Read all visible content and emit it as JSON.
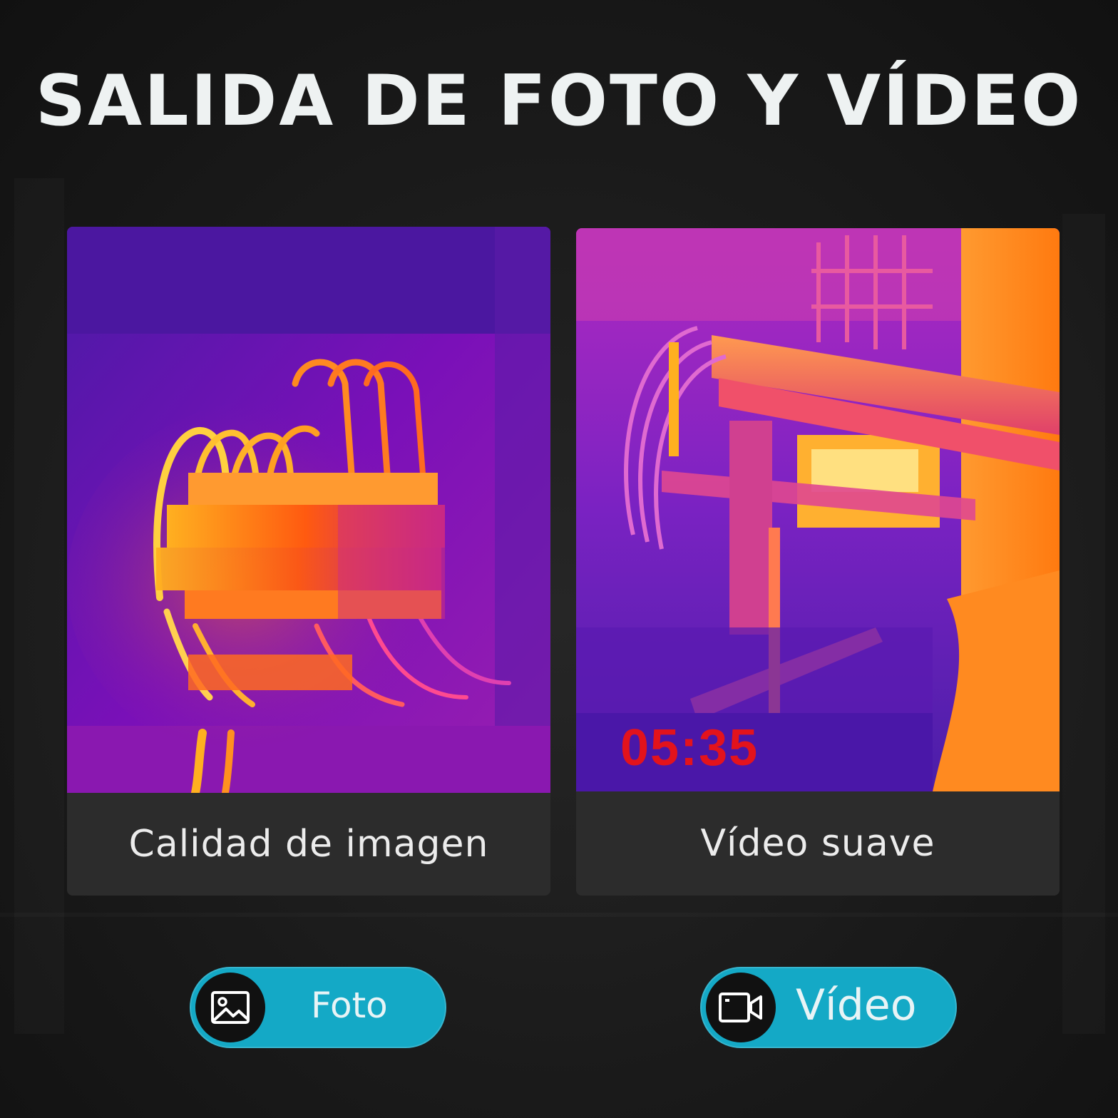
{
  "header": {
    "title": "SALIDA DE FOTO Y VÍDEO"
  },
  "cards": [
    {
      "caption": "Calidad de imagen",
      "image_subject": "thermal image of electrical wiring and terminal blocks"
    },
    {
      "caption": "Vídeo suave",
      "image_subject": "thermal video frame of industrial pipes and machinery",
      "timer": "05:35"
    }
  ],
  "modes": [
    {
      "label": "Foto",
      "icon": "image-icon"
    },
    {
      "label": "Vídeo",
      "icon": "video-camera-icon"
    }
  ],
  "colors": {
    "background": "#161616",
    "title": "#eef2f2",
    "caption_bar": "#2c2c2c",
    "pill": "#14a9c6",
    "pill_icon_bg": "#111111",
    "timer": "#e3131c"
  }
}
